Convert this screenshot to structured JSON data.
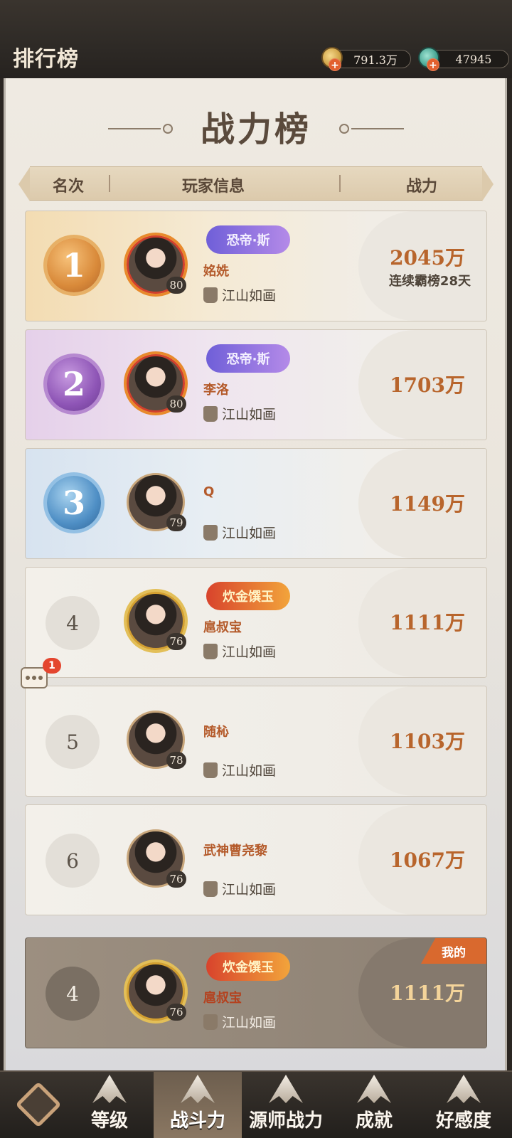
{
  "header": {
    "title": "排行榜",
    "currencies": [
      {
        "icon": "coin-icon",
        "value": "791.3万"
      },
      {
        "icon": "gem-icon",
        "value": "47945"
      }
    ]
  },
  "board": {
    "title": "战力榜",
    "columns": {
      "rank": "名次",
      "info": "玩家信息",
      "power": "战力"
    }
  },
  "rows": [
    {
      "rank": "1",
      "name": "姳姺",
      "title_badge": "恐帝·斯",
      "level": "80",
      "guild": "江山如画",
      "power": "2045万",
      "note": "连续霸榜28天"
    },
    {
      "rank": "2",
      "name": "李洛",
      "title_badge": "恐帝·斯",
      "level": "80",
      "guild": "江山如画",
      "power": "1703万"
    },
    {
      "rank": "3",
      "name": "Q",
      "level": "79",
      "guild": "江山如画",
      "power": "1149万"
    },
    {
      "rank": "4",
      "name": "扈叔宝",
      "title_badge": "炊金馔玉",
      "level": "76",
      "guild": "江山如画",
      "power": "1111万"
    },
    {
      "rank": "5",
      "name": "随杺",
      "level": "78",
      "guild": "江山如画",
      "power": "1103万"
    },
    {
      "rank": "6",
      "name": "武神曹尧黎",
      "level": "76",
      "guild": "江山如画",
      "power": "1067万"
    }
  ],
  "mine": {
    "tag": "我的",
    "rank": "4",
    "name": "扈叔宝",
    "title_badge": "炊金馔玉",
    "level": "76",
    "guild": "江山如画",
    "power": "1111万"
  },
  "chat": {
    "badge": "1"
  },
  "nav": {
    "tabs": [
      "等级",
      "战斗力",
      "源师战力",
      "成就",
      "好感度"
    ],
    "active": "战斗力"
  },
  "colors": {
    "accent": "#b8652c",
    "mine_tag": "#d9692e"
  }
}
